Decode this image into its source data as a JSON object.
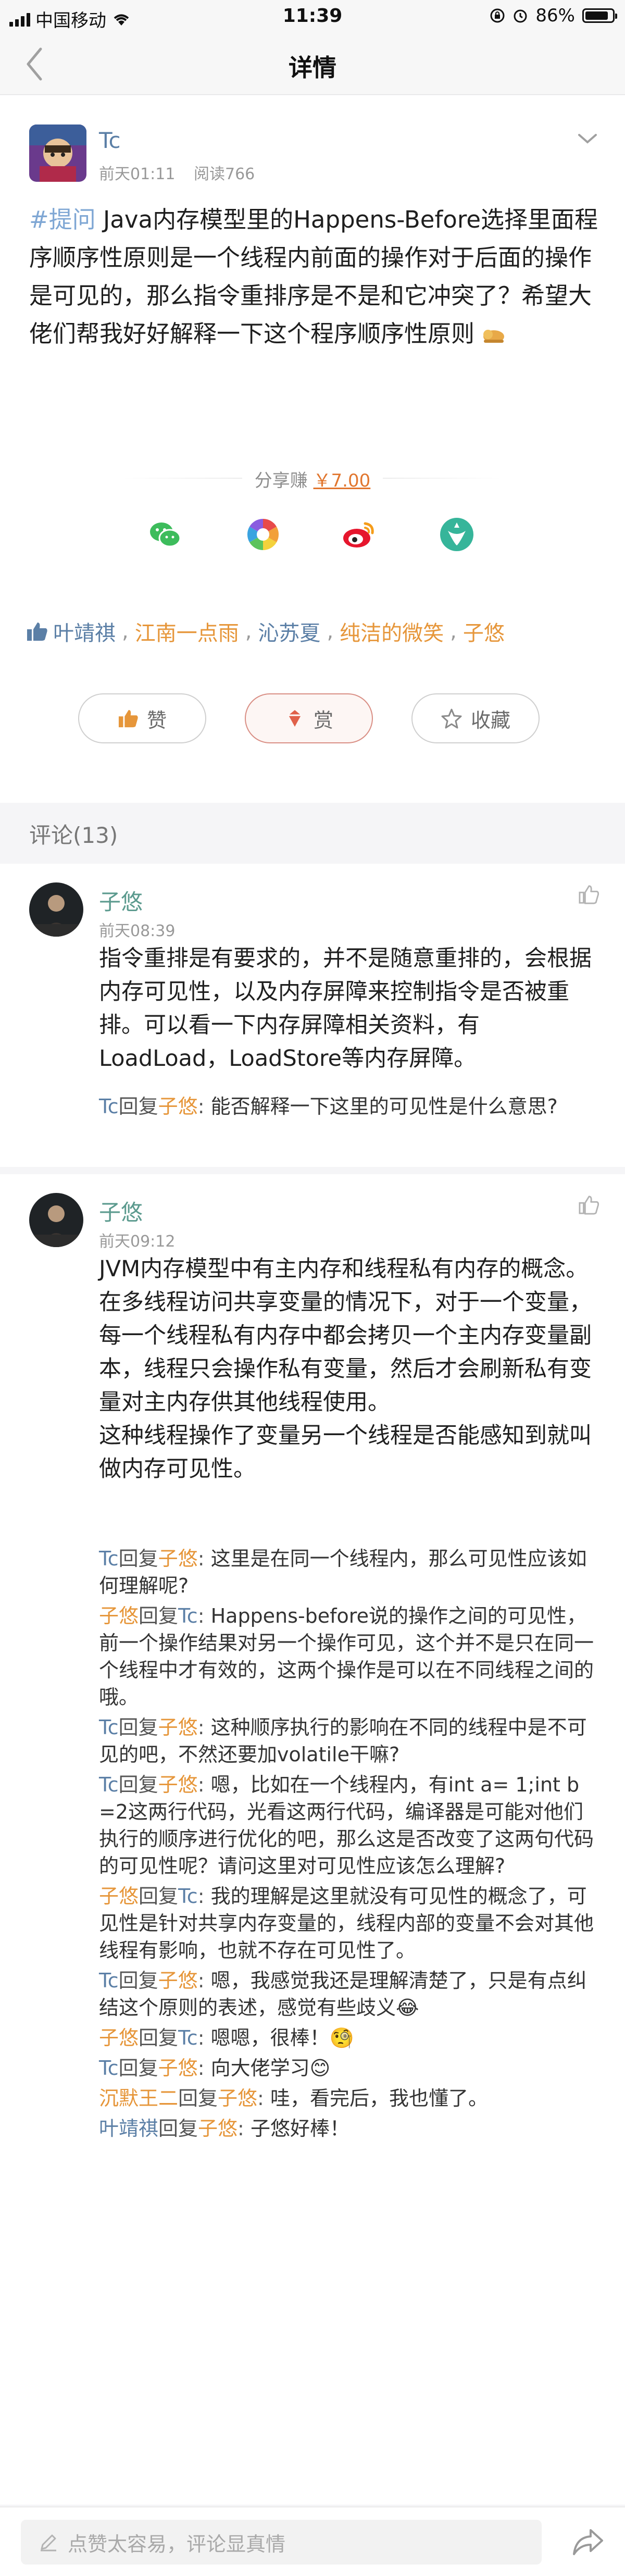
{
  "statusbar": {
    "carrier": "中国移动",
    "time": "11:39",
    "battery": "86%"
  },
  "nav": {
    "title": "详情",
    "back_icon": "chevron-left-icon"
  },
  "post": {
    "author": "Tc",
    "time": "前天01:11",
    "reads": "阅读766",
    "tag": "#提问",
    "content": "Java内存模型里的Happens-Before选择里面程序顺序性原则是一个线程内前面的操作对于后面的操作是可见的，那么指令重排序是不是和它冲突了？希望大佬们帮我好好解释一下这个程序顺序性原则",
    "share_earn_label": "分享赚",
    "share_earn_amount": "￥7.00",
    "share_targets": [
      "wechat-icon",
      "moments-icon",
      "weibo-icon",
      "qzone-icon"
    ],
    "likers": [
      {
        "name": "叶靖祺",
        "color": "blue"
      },
      {
        "name": "江南一点雨",
        "color": "orange"
      },
      {
        "name": "沁苏夏",
        "color": "blue"
      },
      {
        "name": "纯洁的微笑",
        "color": "orange"
      },
      {
        "name": "子悠",
        "color": "orange"
      }
    ],
    "actions": {
      "like": "赞",
      "reward": "赏",
      "favorite": "收藏"
    }
  },
  "comments_header": "评论(13)",
  "comments": [
    {
      "author": "子悠",
      "time": "前天08:39",
      "body": "指令重排是有要求的，并不是随意重排的，会根据内存可见性，以及内存屏障来控制指令是否被重排。可以看一下内存屏障相关资料，有LoadLoad，LoadStore等内存屏障。",
      "replies": [
        {
          "from": "Tc",
          "to": "子悠",
          "text": "能否解释一下这里的可见性是什么意思?"
        }
      ]
    },
    {
      "author": "子悠",
      "time": "前天09:12",
      "body": "JVM内存模型中有主内存和线程私有内存的概念。在多线程访问共享变量的情况下，对于一个变量，每一个线程私有内存中都会拷贝一个主内存变量副本，线程只会操作私有变量，然后才会刷新私有变量对主内存供其他线程使用。\n这种线程操作了变量另一个线程是否能感知到就叫做内存可见性。",
      "replies": [
        {
          "from": "Tc",
          "to": "子悠",
          "text": "这里是在同一个线程内，那么可见性应该如何理解呢?"
        },
        {
          "from": "子悠",
          "to": "Tc",
          "text": "Happens-before说的操作之间的可见性，前一个操作结果对另一个操作可见，这个并不是只在同一个线程中才有效的，这两个操作是可以在不同线程之间的哦。"
        },
        {
          "from": "Tc",
          "to": "子悠",
          "text": "这种顺序执行的影响在不同的线程中是不可见的吧，不然还要加volatile干嘛?"
        },
        {
          "from": "Tc",
          "to": "子悠",
          "text": "嗯，比如在一个线程内，有int a= 1;int b =2这两行代码，光看这两行代码，编译器是可能对他们执行的顺序进行优化的吧，那么这是否改变了这两句代码的可见性呢？请问这里对可见性应该怎么理解?"
        },
        {
          "from": "子悠",
          "to": "Tc",
          "text": "我的理解是这里就没有可见性的概念了，可见性是针对共享内存变量的，线程内部的变量不会对其他线程有影响，也就不存在可见性了。"
        },
        {
          "from": "Tc",
          "to": "子悠",
          "text": "嗯，我感觉我还是理解清楚了，只是有点纠结这个原则的表述，感觉有些歧义😂"
        },
        {
          "from": "子悠",
          "to": "Tc",
          "text": "嗯嗯，很棒！🧐"
        },
        {
          "from": "Tc",
          "to": "子悠",
          "text": "向大佬学习😊"
        },
        {
          "from": "沉默王二",
          "to": "子悠",
          "text": "哇，看完后，我也懂了。"
        },
        {
          "from": "叶靖祺",
          "to": "子悠",
          "text": "子悠好棒！"
        }
      ]
    }
  ],
  "reply_word": "回复",
  "bottom": {
    "placeholder": "点赞太容易，评论显真情"
  },
  "colors": {
    "link_blue": "#5b7fa6",
    "link_orange": "#e6963a",
    "name_teal": "#5b9a8e",
    "accent_money": "#e1762e"
  }
}
